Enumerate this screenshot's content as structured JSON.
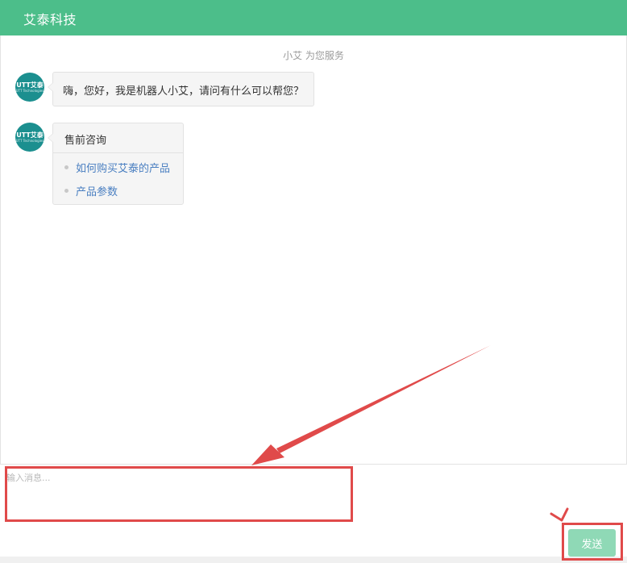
{
  "header": {
    "title": "艾泰科技"
  },
  "chat": {
    "service_note": "小艾 为您服务",
    "avatar": {
      "logo_text": "UTT艾泰",
      "logo_sub": "UTT Technologies"
    },
    "messages": [
      {
        "text": "嗨，您好，我是机器人小艾，请问有什么可以帮您？"
      }
    ],
    "card": {
      "title": "售前咨询",
      "links": [
        "如何购买艾泰的产品",
        "产品参数"
      ]
    }
  },
  "composer": {
    "placeholder": "输入消息...",
    "send_label": "发送"
  },
  "annotations": {
    "highlight_color": "#e04a4a"
  },
  "colors": {
    "header_bg": "#4cbe8a",
    "send_button_bg": "#8fd9b6",
    "link": "#4a7fc1",
    "avatar_bg": "#1b8f8f"
  }
}
